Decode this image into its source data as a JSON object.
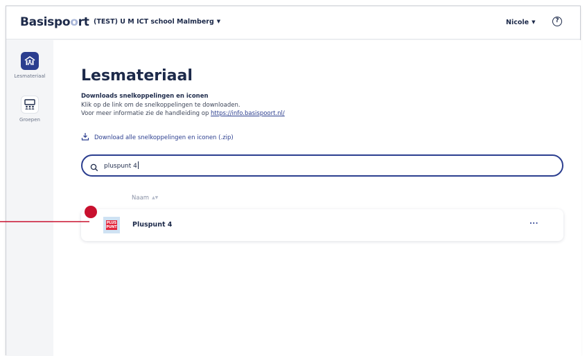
{
  "header": {
    "logo_main": "Basispo",
    "logo_dim": "o",
    "logo_end": "rt",
    "school": "(TEST) U M ICT school Malmberg",
    "user": "Nicole"
  },
  "sidebar": {
    "items": [
      {
        "label": "Lesmateriaal",
        "icon": "building-icon",
        "active": true
      },
      {
        "label": "Groepen",
        "icon": "group-icon",
        "active": false
      }
    ]
  },
  "main": {
    "title": "Lesmateriaal",
    "subheading": "Downloads snelkoppelingen en iconen",
    "info_line1": "Klik op de link om de snelkoppelingen te downloaden.",
    "info_line2_prefix": "Voor meer informatie zie de handleiding op ",
    "info_link": "https://info.basispoort.nl/",
    "download_label": "Download alle snelkoppelingen en iconen (.zip)",
    "search_value": "pluspunt 4",
    "column_header": "Naam",
    "rows": [
      {
        "name": "Pluspunt 4",
        "thumb_text_1": "PLUS",
        "thumb_text_2": "PUNT",
        "menu": "..."
      }
    ]
  },
  "colors": {
    "primary": "#2b3e8f",
    "text": "#1d2a4a",
    "pointer": "#c8102e",
    "thumb_red": "#e2273d"
  }
}
